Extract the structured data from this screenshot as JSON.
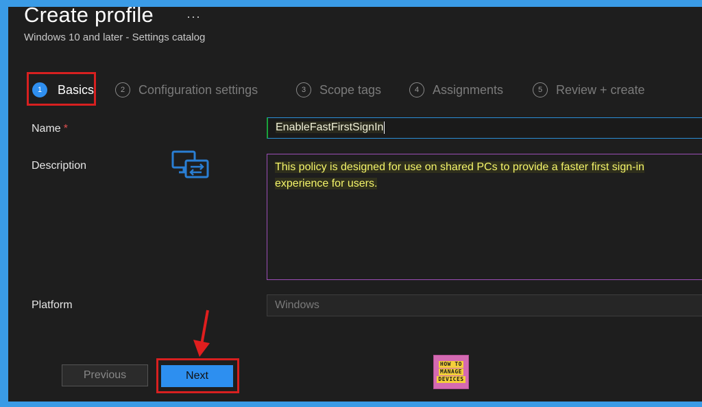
{
  "header": {
    "title": "Create profile",
    "more_icon": "ellipsis-icon",
    "more_label": "···",
    "subtitle": "Windows 10 and later - Settings catalog"
  },
  "steps": [
    {
      "number": "1",
      "label": "Basics",
      "active": true
    },
    {
      "number": "2",
      "label": "Configuration settings",
      "active": false
    },
    {
      "number": "3",
      "label": "Scope tags",
      "active": false
    },
    {
      "number": "4",
      "label": "Assignments",
      "active": false
    },
    {
      "number": "5",
      "label": "Review + create",
      "active": false
    }
  ],
  "form": {
    "name_label": "Name",
    "required_mark": "*",
    "name_value": "EnableFastFirstSignIn",
    "description_label": "Description",
    "description_value": "This policy is designed for use on shared PCs to provide a faster first sign-in experience for users.",
    "platform_label": "Platform",
    "platform_value": "Windows"
  },
  "footer": {
    "previous_label": "Previous",
    "next_label": "Next"
  },
  "logo": {
    "line1": "HOW TO",
    "line2": "MANAGE",
    "line3": "DEVICES"
  },
  "colors": {
    "accent": "#2d8ff0",
    "highlight_border": "#d82020",
    "background": "#1e1e1e",
    "outer_frame": "#3a9be6"
  }
}
